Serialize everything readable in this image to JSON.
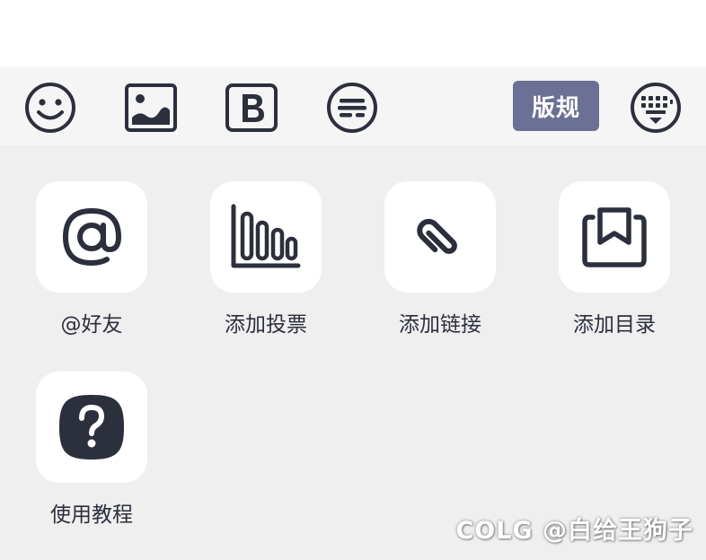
{
  "toolbar": {
    "icons": [
      "emoji-icon",
      "image-icon",
      "bold-icon",
      "text-style-icon",
      "keyboard-icon"
    ],
    "tag_label": "版规"
  },
  "panel": {
    "items": [
      {
        "label": "@好友",
        "icon": "at-icon"
      },
      {
        "label": "添加投票",
        "icon": "poll-icon"
      },
      {
        "label": "添加链接",
        "icon": "link-icon"
      },
      {
        "label": "添加目录",
        "icon": "bookmark-icon"
      },
      {
        "label": "使用教程",
        "icon": "help-icon"
      }
    ]
  },
  "watermark": {
    "text": "COLG @白给王狗子"
  },
  "colors": {
    "icon": "#2c2f3c",
    "accent": "#6c7094",
    "panel_bg": "#efefef",
    "toolbar_bg": "#f5f5f5"
  }
}
